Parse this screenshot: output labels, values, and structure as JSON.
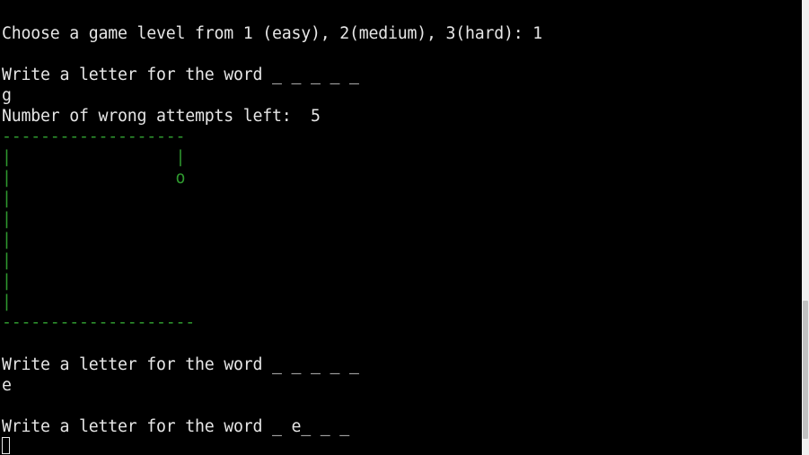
{
  "terminal": {
    "colors": {
      "background": "#000000",
      "text": "#e6e6e6",
      "gallows": "#2f9a2f"
    },
    "lines": [
      "Choose a game level from 1 (easy), 2(medium), 3(hard): 1",
      "Write a letter for the word _ _ _ _ _",
      "g",
      "Number of wrong attempts left:  5",
      "-------------------",
      "|                 |",
      "|                 o",
      "|",
      "|",
      "|",
      "|",
      "|",
      "--------------------",
      "Write a letter for the word _ _ _ _ _",
      "e",
      "Write a letter for the word _ e_ _ _"
    ]
  }
}
